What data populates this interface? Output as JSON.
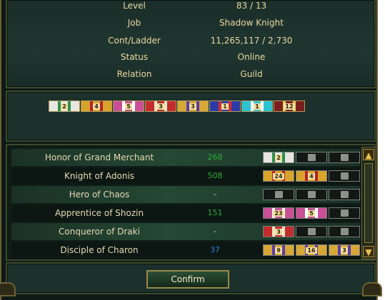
{
  "info": {
    "rows": [
      {
        "label": "Level",
        "value": "83  /  13"
      },
      {
        "label": "Job",
        "value": "Shadow Knight"
      },
      {
        "label": "Cont/Ladder",
        "value": "11,265,117  /  2,730"
      },
      {
        "label": "Status",
        "value": "Online"
      },
      {
        "label": "Relation",
        "value": "Guild"
      }
    ]
  },
  "medals": [
    {
      "num": "2",
      "bg": "#e8e6e1",
      "stripe": "#2f8f4e"
    },
    {
      "num": "4",
      "bg": "#d8a32b",
      "stripe": "#b6202a"
    },
    {
      "num": "5",
      "bg": "#c94f96",
      "stripe": "#ffffff"
    },
    {
      "num": "3",
      "bg": "#c12c2c",
      "stripe": "#f0e4c8"
    },
    {
      "num": "3",
      "bg": "#d5a838",
      "stripe": "#5b3ca3"
    },
    {
      "num": "1",
      "bg": "#2c3aa6",
      "stripe": "#d32f2f"
    },
    {
      "num": "1",
      "bg": "#2cc3d2",
      "stripe": "#ffffff"
    },
    {
      "num": "12",
      "bg": "#7a1f1f",
      "stripe": "#e8cf52"
    }
  ],
  "titles": [
    {
      "name": "Honor of Grand Merchant",
      "count": "268",
      "count_color": "#2fae3d",
      "slots": [
        {
          "num": "2",
          "bg": "#e8e6e1",
          "stripe": "#2f8f4e"
        },
        {
          "locked": true
        },
        {
          "locked": true
        }
      ]
    },
    {
      "name": "Knight of Adonis",
      "count": "508",
      "count_color": "#2fae3d",
      "slots": [
        {
          "num": "24",
          "bg": "#d8a32b",
          "stripe": "#b6202a"
        },
        {
          "num": "4",
          "bg": "#d8a32b",
          "stripe": "#b6202a"
        },
        {
          "locked": true
        }
      ]
    },
    {
      "name": "Hero of Chaos",
      "count": "-",
      "count_color": "#e5d9b4",
      "slots": [
        {
          "locked": true
        },
        {
          "locked": true
        },
        {
          "locked": true
        }
      ]
    },
    {
      "name": "Apprentice of Shozin",
      "count": "151",
      "count_color": "#2fae3d",
      "slots": [
        {
          "num": "23",
          "bg": "#c94f96",
          "stripe": "#ffffff"
        },
        {
          "num": "5",
          "bg": "#c94f96",
          "stripe": "#ffffff"
        },
        {
          "locked": true
        }
      ]
    },
    {
      "name": "Conqueror of Draki",
      "count": "-",
      "count_color": "#e5d9b4",
      "slots": [
        {
          "num": "3",
          "bg": "#c12c2c",
          "stripe": "#f0e4c8"
        },
        {
          "locked": true
        },
        {
          "locked": true
        }
      ]
    },
    {
      "name": "Disciple of Charon",
      "count": "37",
      "count_color": "#2f7fd8",
      "slots": [
        {
          "num": "9",
          "bg": "#d5a838",
          "stripe": "#5b3ca3"
        },
        {
          "num": "16",
          "bg": "#d5a838",
          "stripe": "#5b3ca3"
        },
        {
          "num": "3",
          "bg": "#d5a838",
          "stripe": "#5b3ca3"
        }
      ]
    }
  ],
  "footer": {
    "confirm_label": "Confirm"
  },
  "icons": {
    "scroll_up": "scroll-up-arrow-icon",
    "scroll_down": "scroll-down-arrow-icon",
    "locked_slot": "lock-icon"
  }
}
